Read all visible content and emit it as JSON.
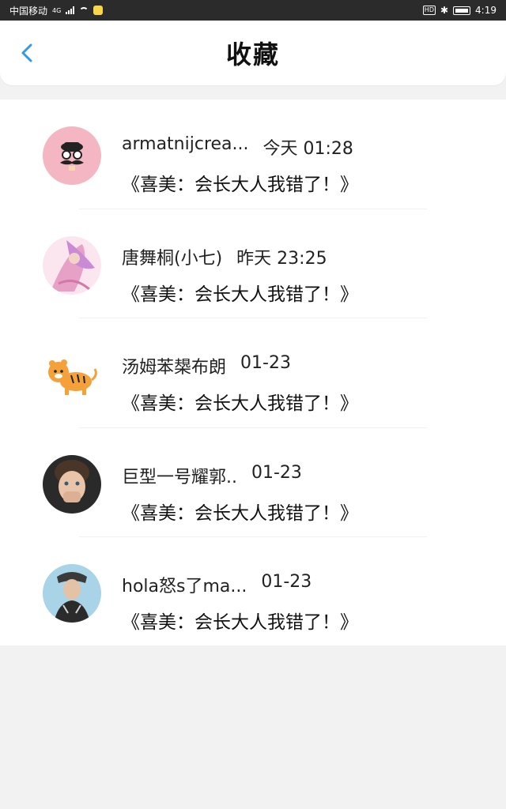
{
  "status_bar": {
    "carrier": "中国移动",
    "network": "4G",
    "time": "4:19",
    "hd": "HD"
  },
  "header": {
    "title": "收藏"
  },
  "favorites": [
    {
      "name": "armatnijcrea...",
      "time": "今天 01:28",
      "content": "《喜美：会长大人我错了！》",
      "avatar": "mustache-avatar-icon"
    },
    {
      "name": "唐舞桐(小七)",
      "time": "昨天 23:25",
      "content": "《喜美：会长大人我错了！》",
      "avatar": "anime-girl-avatar-icon"
    },
    {
      "name": "汤姆苯槼布朗",
      "time": "01-23",
      "content": "《喜美：会长大人我错了！》",
      "avatar": "tiger-avatar-icon"
    },
    {
      "name": "巨型一号耀郭..",
      "time": "01-23",
      "content": "《喜美：会长大人我错了！》",
      "avatar": "child-photo-avatar-icon"
    },
    {
      "name": "hola怒s了ma...",
      "time": "01-23",
      "content": "《喜美：会长大人我错了！》",
      "avatar": "man-photo-avatar-icon"
    }
  ],
  "colors": {
    "accent": "#2f9be6",
    "background": "#f2f2f2"
  }
}
